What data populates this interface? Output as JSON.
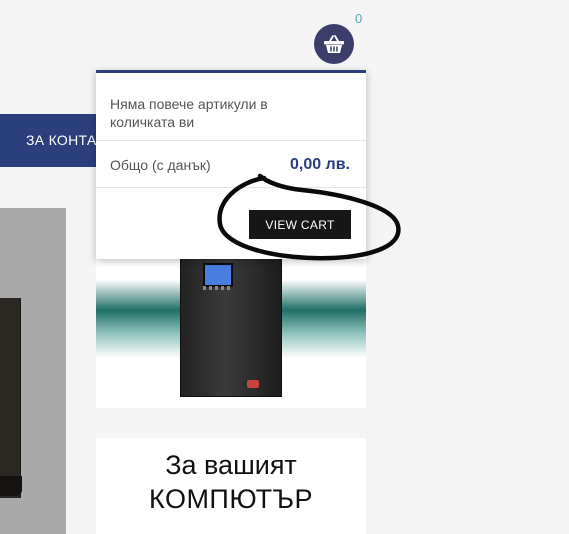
{
  "header": {
    "cart": {
      "count": "0",
      "icon": "basket-icon",
      "button_color": "#3d3d6b"
    }
  },
  "nav": {
    "label": "ЗА КОНТАКТ",
    "color": "#2a3f7c"
  },
  "cart_popup": {
    "message": "Няма повече артикули в количката ви",
    "total_label": "Общо (с данък)",
    "total_value": "0,00 лв.",
    "view_cart_label": "VIEW CART"
  },
  "promo": {
    "line1": "За вашият",
    "line2": "КОМПЮТЪР"
  }
}
